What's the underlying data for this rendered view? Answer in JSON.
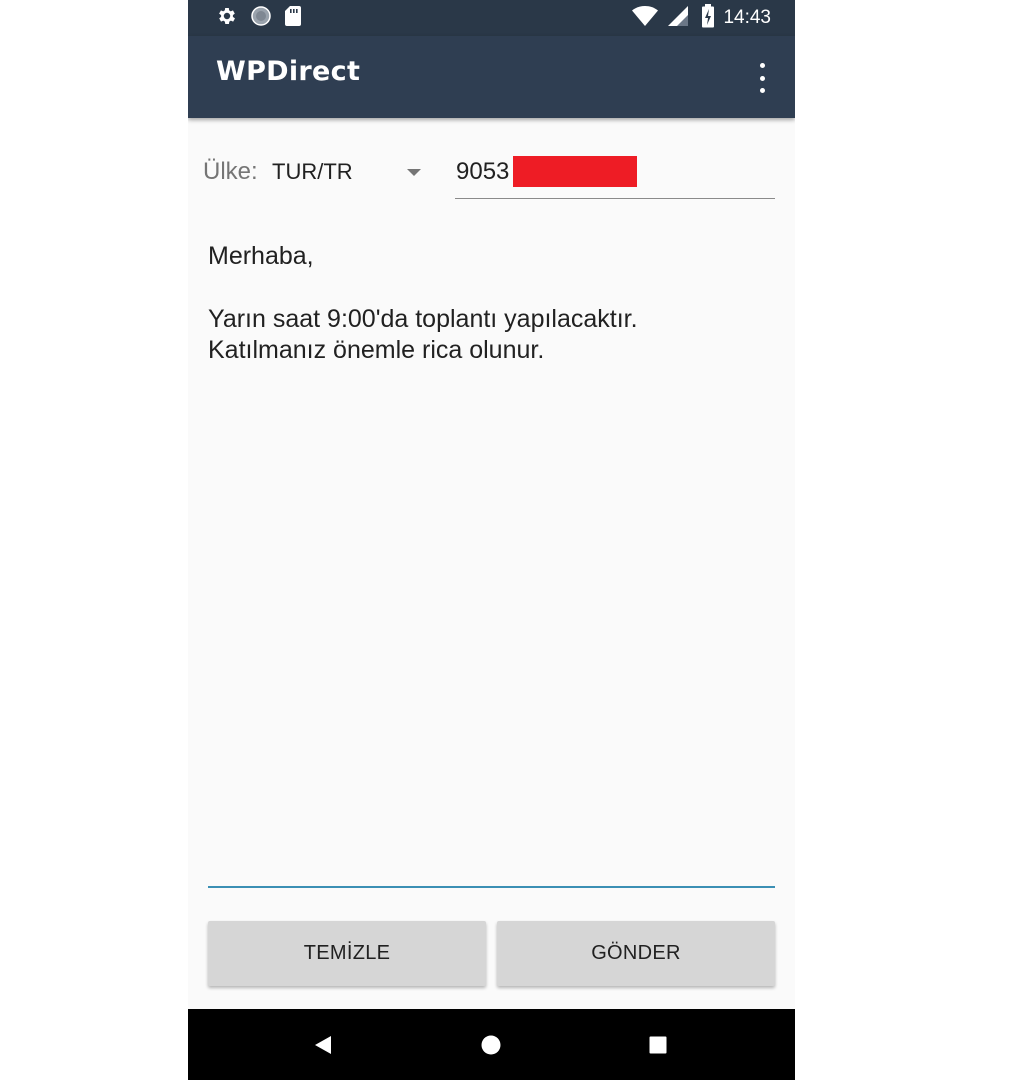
{
  "status_bar": {
    "time": "14:43",
    "left_icons": [
      "gear-icon",
      "circle-status-icon",
      "sd-card-icon"
    ],
    "right_icons": [
      "wifi-icon",
      "signal-icon",
      "battery-charging-icon"
    ]
  },
  "app_bar": {
    "title": "WPDirect",
    "overflow_icon": "more-vert-icon"
  },
  "country": {
    "label": "Ülke:",
    "selected": "TUR/TR"
  },
  "phone": {
    "value": "9053",
    "redaction_color": "#ee1c25"
  },
  "message": {
    "lines": [
      "Merhaba,",
      "",
      "Yarın saat 9:00'da toplantı yapılacaktır.",
      "Katılmanız önemle rica olunur."
    ]
  },
  "buttons": {
    "clear_label": "TEMİZLE",
    "send_label": "GÖNDER"
  },
  "nav_bar": {
    "icons": [
      "back-icon",
      "home-icon",
      "recents-icon"
    ]
  },
  "colors": {
    "status_bar": "#2a3848",
    "app_bar": "#2f3e52",
    "accent": "#3b8fb4",
    "button": "#d6d6d6"
  }
}
